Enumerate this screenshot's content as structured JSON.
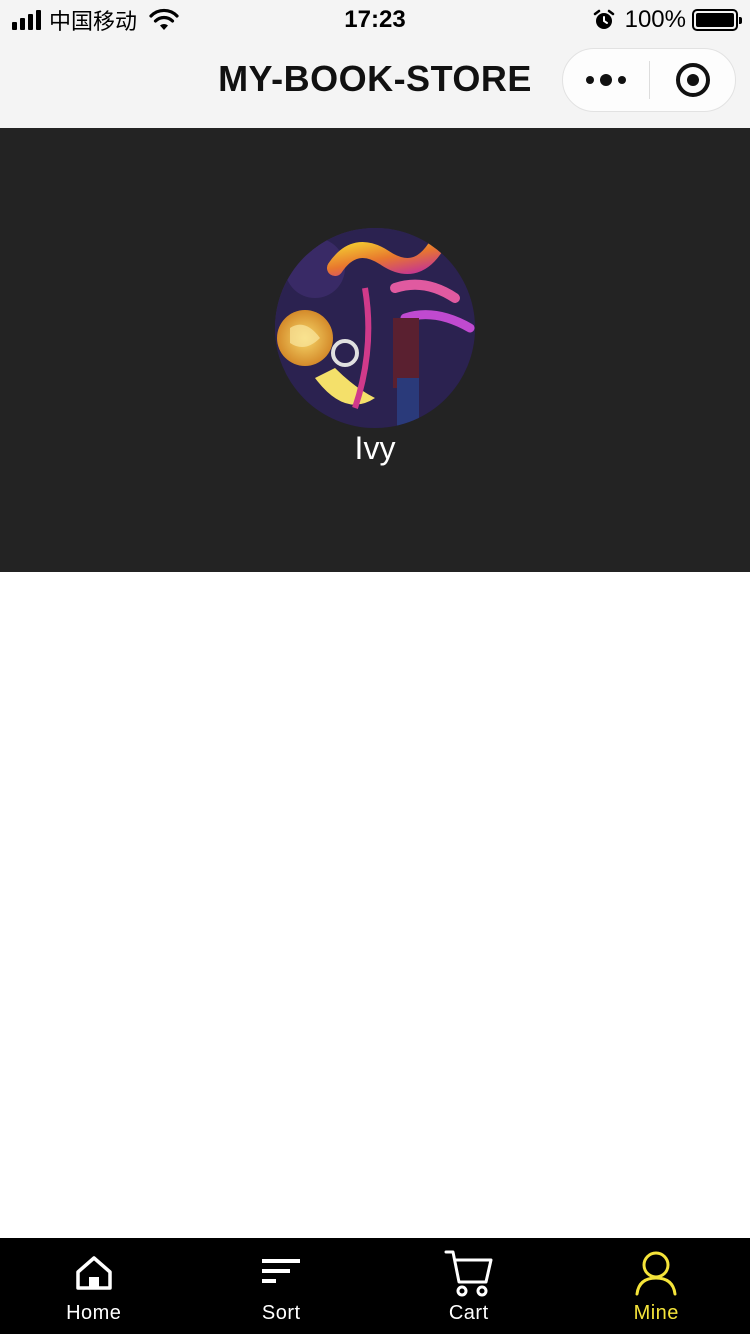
{
  "status_bar": {
    "carrier": "中国移动",
    "time": "17:23",
    "battery": "100%"
  },
  "nav": {
    "title": "MY-BOOK-STORE"
  },
  "profile": {
    "username": "Ivy"
  },
  "tabs": [
    {
      "label": "Home",
      "icon": "home-icon",
      "active": false
    },
    {
      "label": "Sort",
      "icon": "sort-icon",
      "active": false
    },
    {
      "label": "Cart",
      "icon": "cart-icon",
      "active": false
    },
    {
      "label": "Mine",
      "icon": "user-icon",
      "active": true
    }
  ],
  "colors": {
    "header_bg": "#232323",
    "tab_bar_bg": "#000000",
    "tab_active": "#f5e43a",
    "nav_bg": "#f4f4f4"
  }
}
